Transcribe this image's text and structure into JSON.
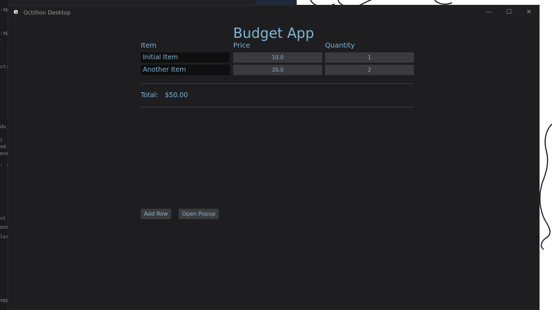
{
  "background": {
    "editor_fragments": [
      ":ap",
      ":ap",
      "'",
      "ct:",
      "du",
      "l",
      "ed",
      "exe",
      ": :",
      "st",
      "ons",
      "ler",
      "opp"
    ]
  },
  "window": {
    "title": "Octillion Desktop",
    "app_icon_glyph": "e",
    "controls": {
      "minimize": "—",
      "maximize": "☐",
      "close": "✕"
    }
  },
  "app": {
    "title": "Budget App",
    "columns": {
      "item": "Item",
      "price": "Price",
      "quantity": "Quantity"
    },
    "rows": [
      {
        "item": "Initial Item",
        "price": "10.0",
        "quantity": "1"
      },
      {
        "item": "Another Item",
        "price": "20.0",
        "quantity": "2"
      }
    ],
    "total_label": "Total:",
    "total_value": "$50.00",
    "buttons": {
      "add_row": "Add Row",
      "open_popup": "Open Popup"
    }
  },
  "colors": {
    "accent": "#7fb7d8",
    "window_bg": "#1e1e20",
    "field_bg": "#3b3b3e",
    "text_field_bg": "#0f0f10"
  }
}
